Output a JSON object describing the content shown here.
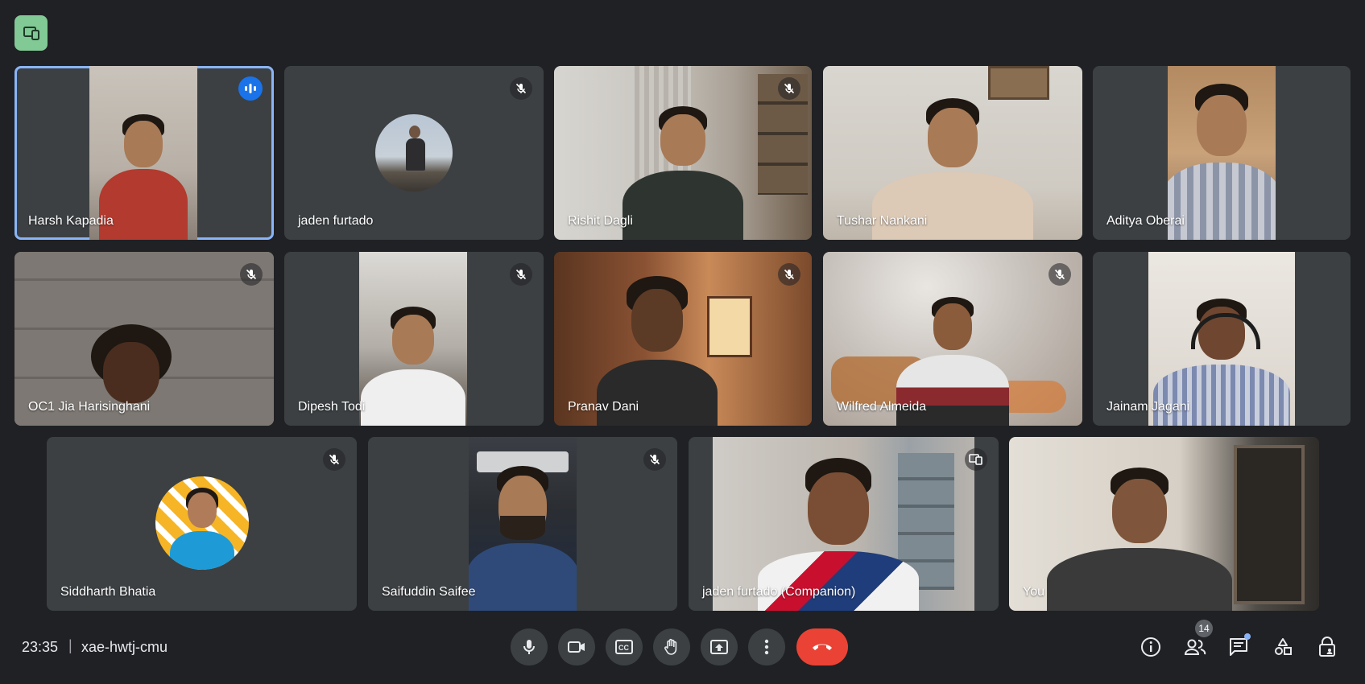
{
  "participants": [
    {
      "name": "Harsh Kapadia"
    },
    {
      "name": "jaden furtado"
    },
    {
      "name": "Rishit Dagli"
    },
    {
      "name": "Tushar Nankani"
    },
    {
      "name": "Aditya Oberai"
    },
    {
      "name": "OC1 Jia Harisinghani"
    },
    {
      "name": "Dipesh Todi"
    },
    {
      "name": "Pranav Dani"
    },
    {
      "name": "Wilfred Almeida"
    },
    {
      "name": "Jainam Jagani"
    },
    {
      "name": "Siddharth Bhatia"
    },
    {
      "name": "Saifuddin Saifee"
    },
    {
      "name": "jaden furtado (Companion)"
    },
    {
      "name": "You"
    }
  ],
  "meeting": {
    "time": "23:35",
    "separator": "|",
    "code": "xae-hwtj-cmu",
    "people_count": "14"
  },
  "colors": {
    "background": "#202124",
    "tile": "#3c4043",
    "active_outline": "#8ab4f8",
    "end_call": "#ea4335",
    "companion_badge": "#81c995",
    "speaking_indicator": "#1a73e8"
  },
  "icons": {
    "companion": "companion-mode-icon",
    "mic": "microphone-icon",
    "camera": "camera-icon",
    "captions": "closed-captions-icon",
    "raise_hand": "raise-hand-icon",
    "present": "present-screen-icon",
    "more": "more-options-icon",
    "end_call": "end-call-icon",
    "info": "meeting-info-icon",
    "people": "people-icon",
    "chat": "chat-icon",
    "activities": "activities-icon",
    "host_controls": "host-controls-icon"
  }
}
